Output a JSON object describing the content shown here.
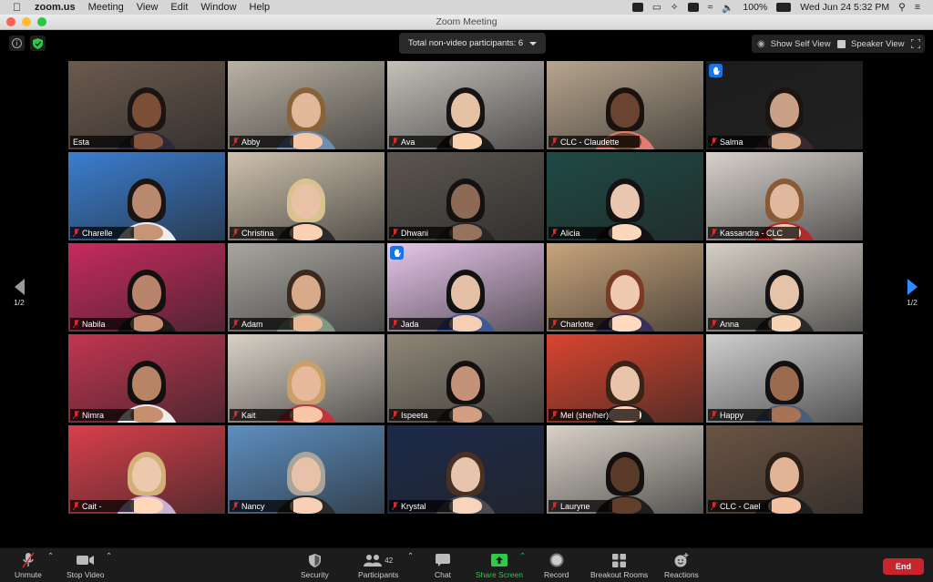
{
  "menubar": {
    "app": "zoom.us",
    "items": [
      "Meeting",
      "View",
      "Edit",
      "Window",
      "Help"
    ],
    "battery": "100%",
    "datetime": "Wed Jun 24  5:32 PM"
  },
  "window": {
    "title": "Zoom Meeting"
  },
  "topbar": {
    "nonvideo_label": "Total non-video participants: 6",
    "show_self_view": "Show Self View",
    "speaker_view": "Speaker View"
  },
  "pagination": {
    "left": "1/2",
    "right": "1/2"
  },
  "participants": [
    {
      "name": "Esta",
      "muted": false,
      "active": true,
      "bg": "#6b5a4e",
      "shirt": "#2c2a3a",
      "skin": "#7a4f36",
      "hair": "#1a1412"
    },
    {
      "name": "Abby",
      "muted": true,
      "bg": "#b9b2a4",
      "shirt": "#6f8db0",
      "skin": "#e2b89a",
      "hair": "#8a6238"
    },
    {
      "name": "Ava",
      "muted": true,
      "bg": "#c4c0ba",
      "shirt": "#1a1a1a",
      "skin": "#e6c2a4",
      "hair": "#141414"
    },
    {
      "name": "CLC - Claudette",
      "muted": true,
      "bg": "#b7a58e",
      "shirt": "#e07d6f",
      "skin": "#6a4430",
      "hair": "#1a120e"
    },
    {
      "name": "Salma",
      "muted": true,
      "raised_hand": true,
      "bg": "#1c1c1c",
      "shirt": "#3a2a2e",
      "skin": "#c99f85",
      "hair": "#1a1412"
    },
    {
      "name": "Charelle",
      "muted": true,
      "bg": "#3b7ed0",
      "shirt": "#eeeeee",
      "skin": "#b9896d",
      "hair": "#1a1412"
    },
    {
      "name": "Christina",
      "muted": true,
      "bg": "#cfc2ae",
      "shirt": "#2a2a2a",
      "skin": "#e9c1a6",
      "hair": "#d8c28d"
    },
    {
      "name": "Dhwani",
      "muted": true,
      "bg": "#5c5650",
      "shirt": "#2a2623",
      "skin": "#8c6a56",
      "hair": "#141210"
    },
    {
      "name": "Alicia",
      "muted": true,
      "bg": "#1f4a44",
      "shirt": "#111111",
      "skin": "#e8c7ae",
      "hair": "#121212"
    },
    {
      "name": "Kassandra - CLC",
      "muted": true,
      "bg": "#d8d2cc",
      "shirt": "#b42a2a",
      "skin": "#e0b89e",
      "hair": "#8a5a36"
    },
    {
      "name": "Nabila",
      "muted": true,
      "bg": "#c82a5e",
      "shirt": "#1a1a1a",
      "skin": "#b9856a",
      "hair": "#141010"
    },
    {
      "name": "Adam",
      "muted": true,
      "bg": "#a9a6a0",
      "shirt": "#7f9a82",
      "skin": "#d9aa8a",
      "hair": "#3a2a1e"
    },
    {
      "name": "Jada",
      "muted": true,
      "raised_hand": true,
      "bg": "#e7c6ea",
      "shirt": "#3a5a9a",
      "skin": "#e3c0a6",
      "hair": "#121212"
    },
    {
      "name": "Charlotte",
      "muted": true,
      "bg": "#c7a47c",
      "shirt": "#3a2e5c",
      "skin": "#efcab0",
      "hair": "#7a3a24"
    },
    {
      "name": "Anna",
      "muted": true,
      "bg": "#d6d0c6",
      "shirt": "#2a2a2a",
      "skin": "#e5c3a8",
      "hair": "#141414"
    },
    {
      "name": "Nimra",
      "muted": true,
      "bg": "#c23552",
      "shirt": "#eeeeee",
      "skin": "#b78466",
      "hair": "#121010"
    },
    {
      "name": "Kait",
      "muted": true,
      "bg": "#d9d1c6",
      "shirt": "#c0343a",
      "skin": "#e6b99a",
      "hair": "#caa06a"
    },
    {
      "name": "Ispeeta",
      "muted": true,
      "bg": "#8f8778",
      "shirt": "#2a2a2a",
      "skin": "#c49278",
      "hair": "#121010"
    },
    {
      "name": "Mel (she/her)",
      "muted": true,
      "bg": "#d9452f",
      "shirt": "#1e1e1e",
      "skin": "#eac4aa",
      "hair": "#3a2418"
    },
    {
      "name": "Happy",
      "muted": true,
      "bg": "#cfcfcf",
      "shirt": "#4a5e7a",
      "skin": "#9c6a4e",
      "hair": "#121010"
    },
    {
      "name": "Cait -",
      "muted": true,
      "bg": "#d93f4b",
      "shirt": "#c9b2d9",
      "skin": "#ecc8ac",
      "hair": "#d2b178"
    },
    {
      "name": "Nancy",
      "muted": true,
      "bg": "#5d8fc0",
      "shirt": "#2a2a2a",
      "skin": "#e7c1a8",
      "hair": "#a9a49a"
    },
    {
      "name": "Krystal",
      "muted": true,
      "bg": "#1c2a4a",
      "shirt": "#4a4a52",
      "skin": "#e6c4ae",
      "hair": "#4a3022"
    },
    {
      "name": "Lauryne",
      "muted": true,
      "bg": "#d8d2c8",
      "shirt": "#1e1e1e",
      "skin": "#5a3a28",
      "hair": "#121010"
    },
    {
      "name": "CLC - Cael",
      "muted": true,
      "bg": "#6a5444",
      "shirt": "#1e1e1e",
      "skin": "#e2b496",
      "hair": "#2a1e16"
    }
  ],
  "toolbar": {
    "unmute": "Unmute",
    "stop_video": "Stop Video",
    "security": "Security",
    "participants": "Participants",
    "participant_count": "42",
    "chat": "Chat",
    "share_screen": "Share Screen",
    "record": "Record",
    "breakout_rooms": "Breakout Rooms",
    "reactions": "Reactions",
    "end": "End"
  },
  "colors": {
    "active_speaker": "#c7e36a",
    "share_green": "#2ec84a",
    "end_red": "#c8242b",
    "raised_hand_blue": "#1b74e4",
    "next_arrow_blue": "#2d8cff"
  }
}
